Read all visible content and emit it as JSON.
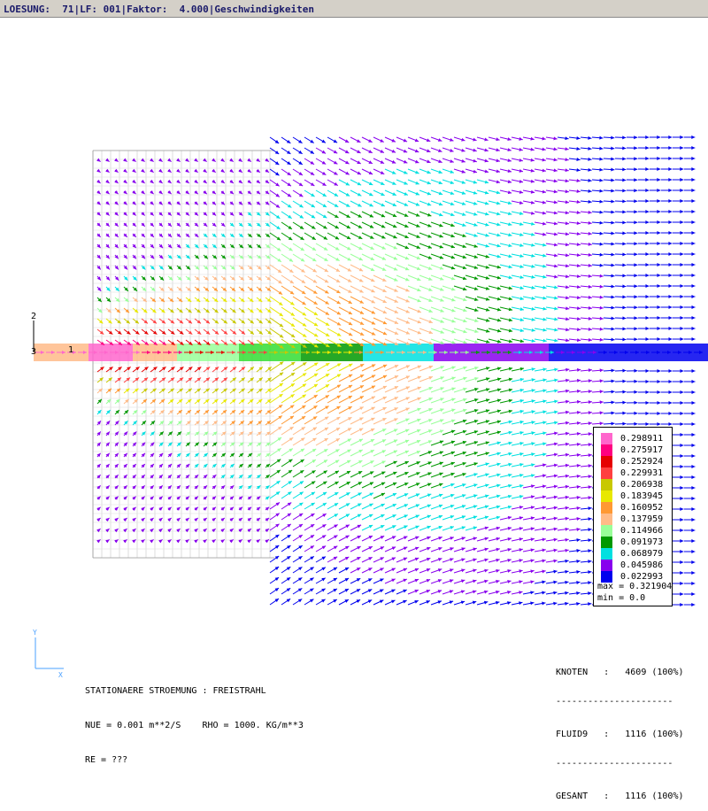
{
  "title_bar": "LOESUNG:  71|LF: 001|Faktor:  4.000|Geschwindigkeiten",
  "legend": {
    "entries": [
      {
        "value": "0.298911",
        "color": "#ff66cc"
      },
      {
        "value": "0.275917",
        "color": "#ff0080"
      },
      {
        "value": "0.252924",
        "color": "#e60000"
      },
      {
        "value": "0.229931",
        "color": "#ff4040"
      },
      {
        "value": "0.206938",
        "color": "#c8c800"
      },
      {
        "value": "0.183945",
        "color": "#e8e800"
      },
      {
        "value": "0.160952",
        "color": "#ff9933"
      },
      {
        "value": "0.137959",
        "color": "#ffbb88"
      },
      {
        "value": "0.114966",
        "color": "#99ff99"
      },
      {
        "value": "0.091973",
        "color": "#009900"
      },
      {
        "value": "0.068979",
        "color": "#00e0e0"
      },
      {
        "value": "0.045986",
        "color": "#8800ee"
      },
      {
        "value": "0.022993",
        "color": "#0000ee"
      }
    ],
    "max_text": "max = 0.321904",
    "min_text": "min = 0.0"
  },
  "axis_labels": {
    "node_2": "2",
    "node_3": "3",
    "node_1": "1",
    "triad_y": "Y",
    "triad_x": "X"
  },
  "info": {
    "line1": "STATIONAERE STROEMUNG : FREISTRAHL",
    "line2": "NUE = 0.001 m**2/S    RHO = 1000. KG/m**3",
    "line3": "RE = ???"
  },
  "stats": {
    "knoten": "KNOTEN   :   4609 (100%)",
    "fluid9": "FLUID9   :   1116 (100%)",
    "gesamt": "GESANT   :   1116 (100%)"
  }
}
